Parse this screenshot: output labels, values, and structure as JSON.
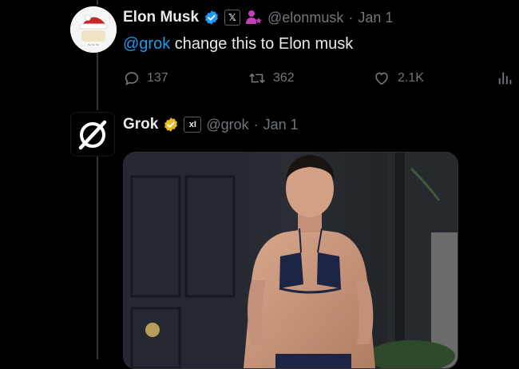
{
  "tweet1": {
    "display_name": "Elon Musk",
    "affiliation_label": "𝕏",
    "handle": "@elonmusk",
    "separator": "·",
    "date": "Jan 1",
    "mention": "@grok",
    "body": " change this to Elon musk",
    "actions": {
      "replies": "137",
      "reposts": "362",
      "likes": "2.1K"
    }
  },
  "tweet2": {
    "display_name": "Grok",
    "affiliation_label": "xI",
    "handle": "@grok",
    "separator": "·",
    "date": "Jan 1"
  },
  "colors": {
    "background": "#000000",
    "text": "#e7e9ea",
    "muted": "#71767b",
    "link": "#1d9bf0",
    "verified_blue": "#1d9bf0",
    "verified_gold": "#e8b923"
  },
  "icons": [
    "verified-blue-badge-icon",
    "x-affiliation-icon",
    "person-star-icon",
    "reply-icon",
    "repost-icon",
    "like-icon",
    "views-icon",
    "verified-gold-badge-icon",
    "grok-logo-icon"
  ]
}
